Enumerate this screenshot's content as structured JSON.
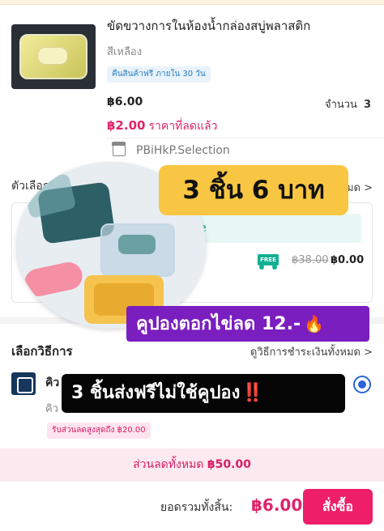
{
  "product": {
    "title": "ขัดขวางการในห้องน้ำกล่องสบู่พลาสติก",
    "variant": "สีเหลือง",
    "return_badge": "คืนสินค้าฟรี ภายใน 30 วัน",
    "price": "฿6.00",
    "quantity_label": "จำนวน",
    "quantity_value": "3",
    "discount_amount": "฿2.00",
    "discount_label": "ราคาที่ลดแล้ว",
    "store_name": "PBiHkP.Selection"
  },
  "options": {
    "title": "ตัวเลือก",
    "see_all": "หมด >",
    "choice_label": "oice",
    "free_tag": "FREE",
    "shipping_old": "฿38.00",
    "shipping_new": "฿0.00"
  },
  "payment": {
    "title": "เลือกวิธีการ",
    "see_all": "ดูวิธีการชำระเงินทั้งหมด >",
    "method_name": "คิว",
    "method_sub": "คิว",
    "promo": "รับส่วนลดสูงสุดถึง ฿20.00"
  },
  "summary": {
    "total_discount_label": "ส่วนลดทั้งหมด",
    "total_discount_value": "฿50.00",
    "grand_total_label": "ยอดรวมทั้งสิ้น:",
    "grand_total_value": "฿6.00",
    "checkout_label": "สั่งซื้อ"
  },
  "overlay": {
    "headline": "3 ชิ้น 6 บาท",
    "coupon_text": "คูปองตอกไข่ลด 12.-",
    "coupon_emoji": "🔥",
    "shipping_text": "3 ชิ้นส่งฟรีไม่ใช้คูปอง",
    "shipping_emoji": "‼️"
  },
  "colors": {
    "accent": "#ee1f68",
    "discount_text": "#e0246b",
    "headline_bg": "#f8c642",
    "coupon_bg": "#7a1ec0",
    "shipping_bg": "#050505",
    "free_green": "#12b092"
  }
}
